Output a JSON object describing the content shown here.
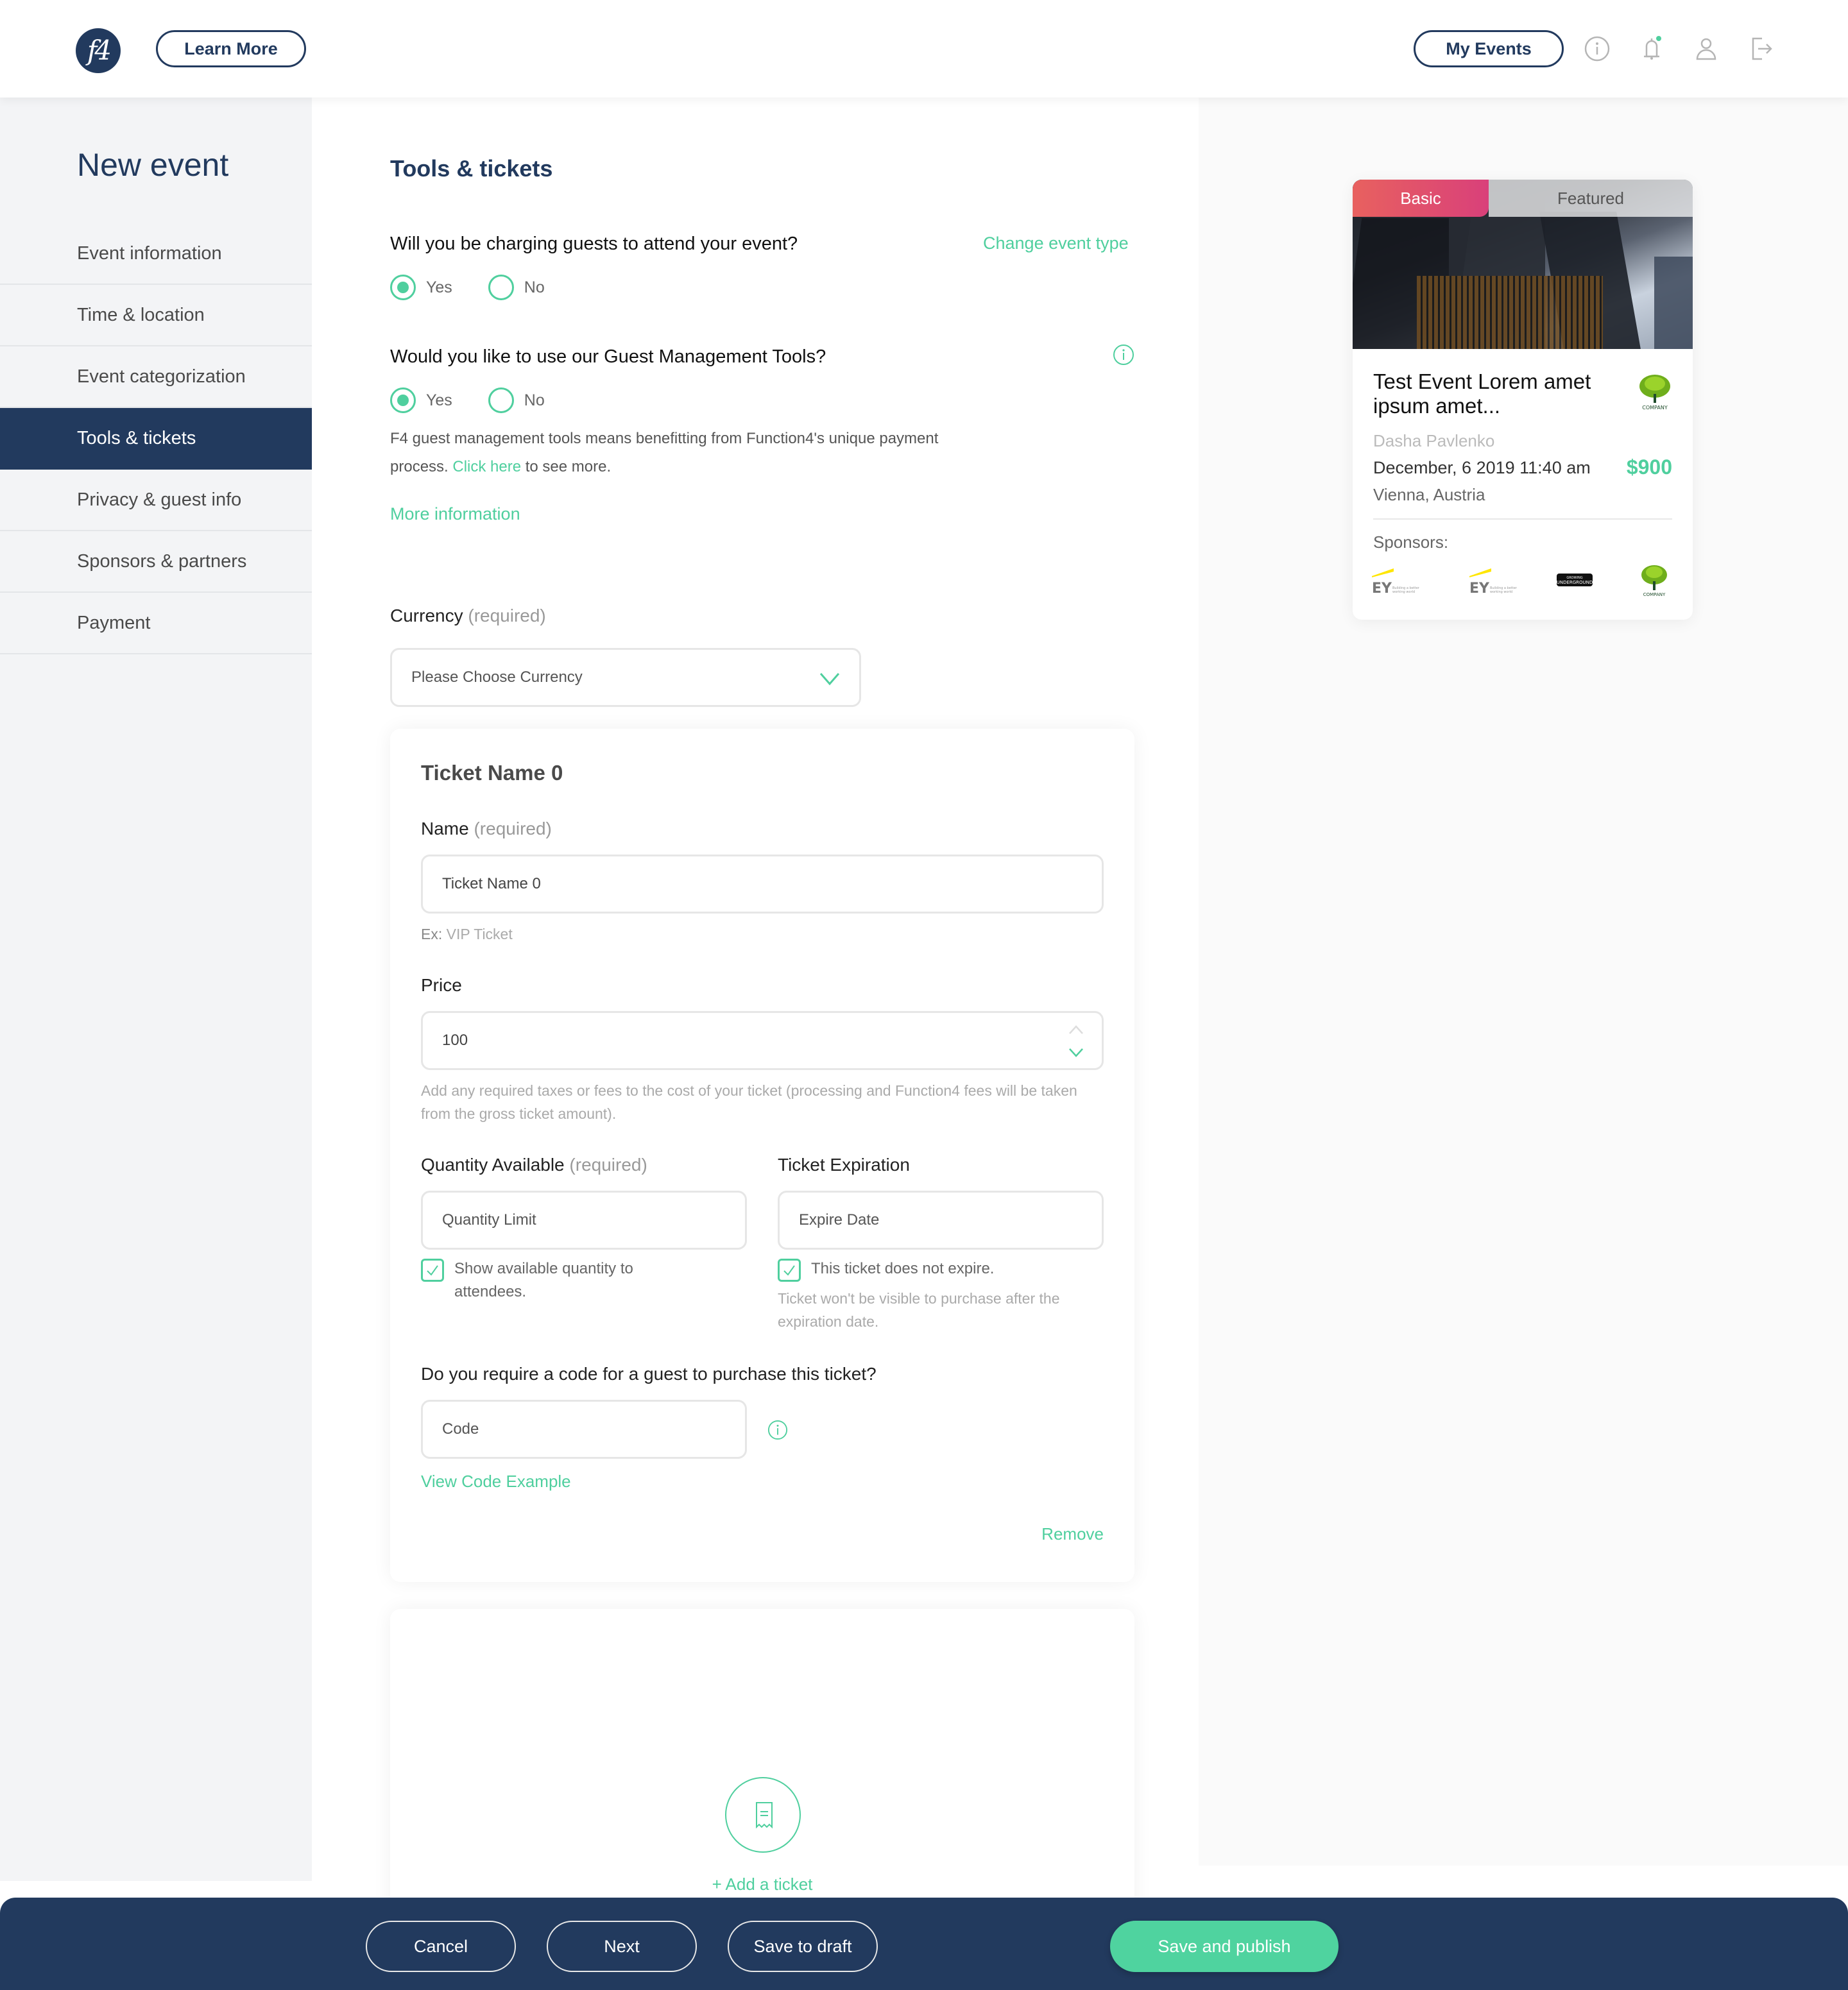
{
  "header": {
    "logo_text": "f4",
    "learn_more": "Learn More",
    "my_events": "My Events",
    "icons": [
      "info-icon",
      "bell-icon",
      "user-icon",
      "logout-icon"
    ],
    "notification_dot_color": "#4fcf9e"
  },
  "sidebar": {
    "title": "New event",
    "items": [
      {
        "label": "Event information",
        "active": false
      },
      {
        "label": "Time & location",
        "active": false
      },
      {
        "label": "Event categorization",
        "active": false
      },
      {
        "label": "Tools & tickets",
        "active": true
      },
      {
        "label": "Privacy & guest info",
        "active": false
      },
      {
        "label": "Sponsors & partners",
        "active": false
      },
      {
        "label": "Payment",
        "active": false
      }
    ]
  },
  "main": {
    "section_title": "Tools & tickets",
    "charging": {
      "question": "Will you be charging guests to attend your event?",
      "change_link": "Change event type",
      "options": [
        "Yes",
        "No"
      ],
      "selected": "Yes"
    },
    "guest_tools": {
      "question": "Would you like to use our Guest Management Tools?",
      "options": [
        "Yes",
        "No"
      ],
      "selected": "Yes",
      "description_pre": "F4 guest management tools means benefitting from Function4's unique payment process.",
      "click_here": "Click here",
      "description_post": "to see more.",
      "more_info": "More information"
    },
    "currency": {
      "label": "Currency",
      "required": "(required)",
      "placeholder": "Please Choose Currency"
    },
    "ticket": {
      "title": "Ticket Name 0",
      "name_label": "Name",
      "name_required": "(required)",
      "name_value": "Ticket Name 0",
      "name_hint_prefix": "Ex:",
      "name_hint": "VIP Ticket",
      "price_label": "Price",
      "price_value": "100",
      "price_hint": "Add any required taxes or fees to the cost of your ticket (processing and Function4 fees will be taken from the gross ticket amount).",
      "quantity_label": "Quantity Available",
      "quantity_required": "(required)",
      "quantity_placeholder": "Quantity Limit",
      "show_quantity_label": "Show available quantity to attendees.",
      "show_quantity_checked": true,
      "expiration_label": "Ticket Expiration",
      "expiration_placeholder": "Expire Date",
      "no_expire_label": "This ticket does not expire.",
      "no_expire_checked": true,
      "expiration_hint": "Ticket won't be visible to purchase after the expiration date.",
      "code_question": "Do you require a code for a guest to purchase this ticket?",
      "code_placeholder": "Code",
      "view_code_example": "View Code Example",
      "remove": "Remove"
    },
    "add_ticket": "+ Add a ticket"
  },
  "preview": {
    "tabs": [
      "Basic",
      "Featured"
    ],
    "active_tab": "Basic",
    "title": "Test Event Lorem amet ipsum amet...",
    "organizer": "Dasha Pavlenko",
    "datetime": "December, 6 2019 11:40 am",
    "price": "$900",
    "location": "Vienna, Austria",
    "sponsors_label": "Sponsors:",
    "sponsors": [
      "EY",
      "EY",
      "Growing Underground",
      "Company"
    ],
    "company_logo_text": "COMPANY",
    "ey_tagline": "Building a better working world",
    "underground_text": "UNDERGROUND",
    "growing_text": "GROWING"
  },
  "footer": {
    "cancel": "Cancel",
    "next": "Next",
    "save_draft": "Save to draft",
    "save_publish": "Save and publish"
  },
  "colors": {
    "navy": "#223a5e",
    "accent_green": "#4fcf9e",
    "basic_tab_gradient": [
      "#e8615f",
      "#d9407a"
    ]
  }
}
